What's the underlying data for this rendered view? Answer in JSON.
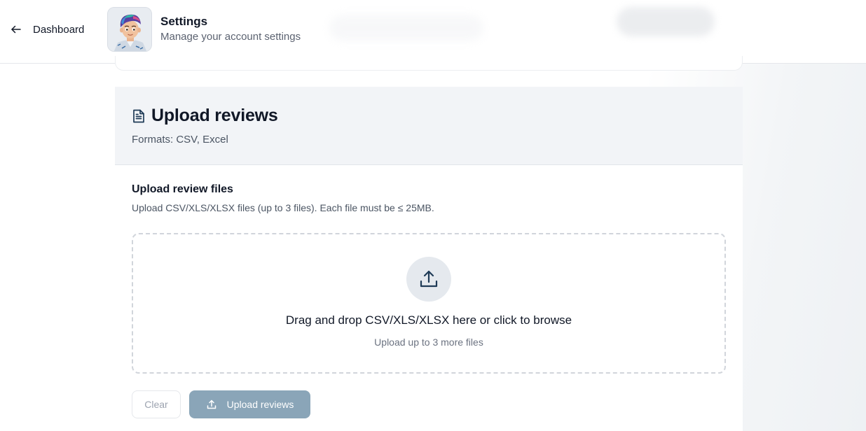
{
  "header": {
    "back_label": "Dashboard",
    "title": "Settings",
    "subtitle": "Manage your account settings"
  },
  "card": {
    "title": "Upload reviews",
    "formats": "Formats: CSV, Excel",
    "section_title": "Upload review files",
    "section_desc": "Upload CSV/XLS/XLSX files (up to 3 files). Each file must be ≤ 25MB.",
    "dropzone": {
      "primary": "Drag and drop CSV/XLS/XLSX here or click to browse",
      "secondary": "Upload up to 3 more files"
    },
    "buttons": {
      "clear": "Clear",
      "upload": "Upload reviews"
    }
  },
  "icons": {
    "back": "arrow-left-icon",
    "title": "document-icon",
    "dropzone": "upload-icon",
    "upload_button": "upload-icon"
  },
  "colors": {
    "upload_button": "#8aa5b8",
    "card_header_bg": "#f2f4f7",
    "upload_circle_bg": "#e5e9ee",
    "icon_stroke": "#1f3b57"
  }
}
